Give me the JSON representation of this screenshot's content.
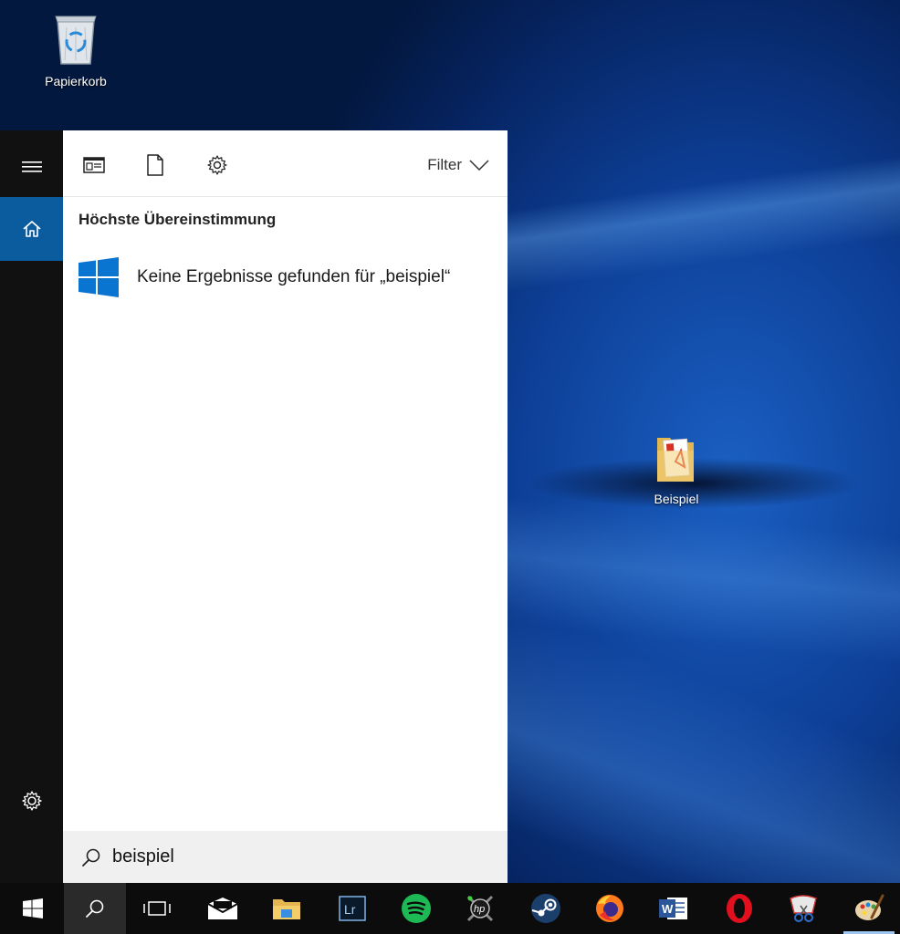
{
  "desktop": {
    "icons": [
      {
        "label": "Papierkorb",
        "icon": "recycle-bin-icon"
      },
      {
        "label": "Beispiel",
        "icon": "folder-icon"
      }
    ]
  },
  "start": {
    "rail": {
      "menu": "hamburger-menu-icon",
      "home": "home-icon",
      "settings": "gear-icon"
    },
    "toolbar": {
      "apps_icon": "apps-filter-icon",
      "documents_icon": "document-filter-icon",
      "settings_icon": "settings-filter-icon",
      "filter_label": "Filter"
    },
    "section_title": "Höchste Übereinstimmung",
    "result": {
      "icon": "windows-logo-icon",
      "text": "Keine Ergebnisse gefunden für „beispiel“"
    },
    "search": {
      "value": "beispiel"
    }
  },
  "taskbar": {
    "items": [
      {
        "name": "start",
        "icon": "windows-start-icon"
      },
      {
        "name": "search",
        "icon": "search-icon",
        "active": true
      },
      {
        "name": "task-view",
        "icon": "task-view-icon"
      },
      {
        "name": "mail",
        "icon": "mail-icon"
      },
      {
        "name": "file-explorer",
        "icon": "folder-icon"
      },
      {
        "name": "lightroom",
        "icon": "lightroom-icon",
        "text": "Lr"
      },
      {
        "name": "spotify",
        "icon": "spotify-icon"
      },
      {
        "name": "hp-app",
        "icon": "hp-icon"
      },
      {
        "name": "steam",
        "icon": "steam-icon"
      },
      {
        "name": "firefox",
        "icon": "firefox-icon"
      },
      {
        "name": "word",
        "icon": "word-icon",
        "text": "W"
      },
      {
        "name": "opera",
        "icon": "opera-icon"
      },
      {
        "name": "snipping-tool",
        "icon": "snipping-tool-icon"
      },
      {
        "name": "paint",
        "icon": "paint-icon",
        "running": true
      }
    ]
  },
  "colors": {
    "accent": "#0a5c9e",
    "rail": "#111111",
    "taskbar": "#0c0c0c",
    "spotify": "#1db954",
    "opera": "#e0101e",
    "word": "#2b579a"
  }
}
